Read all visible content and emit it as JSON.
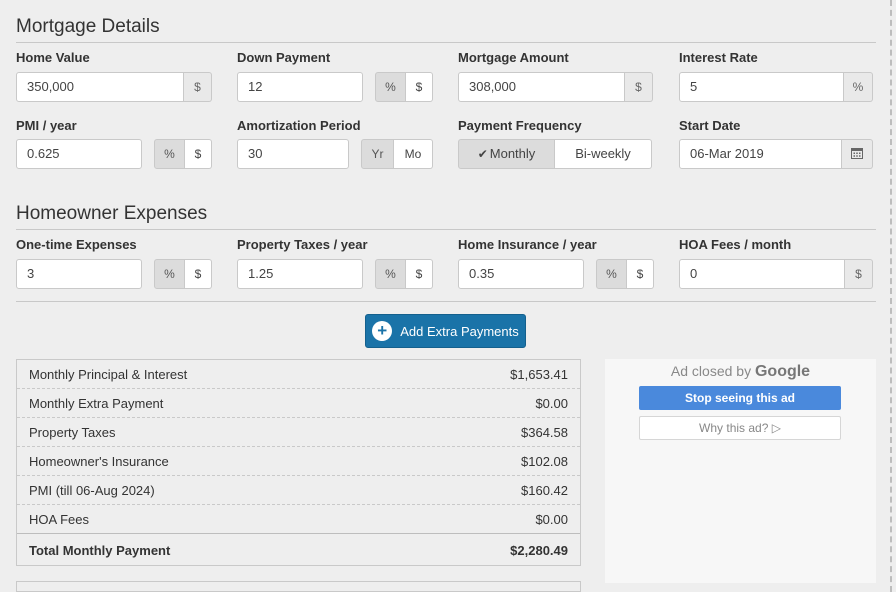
{
  "mortgage": {
    "title": "Mortgage Details",
    "home_value": {
      "label": "Home Value",
      "value": "350,000",
      "unit": "$"
    },
    "down_payment": {
      "label": "Down Payment",
      "value": "12",
      "unit_pct": "%",
      "unit_usd": "$"
    },
    "mortgage_amount": {
      "label": "Mortgage Amount",
      "value": "308,000",
      "unit": "$"
    },
    "interest_rate": {
      "label": "Interest Rate",
      "value": "5",
      "unit": "%"
    },
    "pmi": {
      "label": "PMI / year",
      "value": "0.625",
      "unit_pct": "%",
      "unit_usd": "$"
    },
    "amortization": {
      "label": "Amortization Period",
      "value": "30",
      "unit_yr": "Yr",
      "unit_mo": "Mo"
    },
    "frequency": {
      "label": "Payment Frequency",
      "monthly": "Monthly",
      "biweekly": "Bi-weekly"
    },
    "start_date": {
      "label": "Start Date",
      "value": "06-Mar 2019"
    }
  },
  "expenses": {
    "title": "Homeowner Expenses",
    "one_time": {
      "label": "One-time Expenses",
      "value": "3",
      "unit_pct": "%",
      "unit_usd": "$"
    },
    "property_taxes": {
      "label": "Property Taxes / year",
      "value": "1.25",
      "unit_pct": "%",
      "unit_usd": "$"
    },
    "insurance": {
      "label": "Home Insurance / year",
      "value": "0.35",
      "unit_pct": "%",
      "unit_usd": "$"
    },
    "hoa": {
      "label": "HOA Fees / month",
      "value": "0",
      "unit": "$"
    }
  },
  "add_extra_label": "Add Extra Payments",
  "summary": {
    "rows": [
      {
        "k": "Monthly Principal & Interest",
        "v": "$1,653.41"
      },
      {
        "k": "Monthly Extra Payment",
        "v": "$0.00"
      },
      {
        "k": "Property Taxes",
        "v": "$364.58"
      },
      {
        "k": "Homeowner's Insurance",
        "v": "$102.08"
      },
      {
        "k": "PMI (till 06-Aug 2024)",
        "v": "$160.42"
      },
      {
        "k": "HOA Fees",
        "v": "$0.00"
      }
    ],
    "total": {
      "k": "Total Monthly Payment",
      "v": "$2,280.49"
    }
  },
  "ad": {
    "closed_by": "Ad closed by",
    "google": "Google",
    "stop": "Stop seeing this ad",
    "why": "Why this ad? ▷"
  },
  "icons": {
    "calendar": "calendar-icon",
    "check": "check-icon",
    "plus": "plus-circle-icon"
  },
  "colors": {
    "primary": "#1a73a8",
    "ad_blue": "#4a89dc"
  }
}
